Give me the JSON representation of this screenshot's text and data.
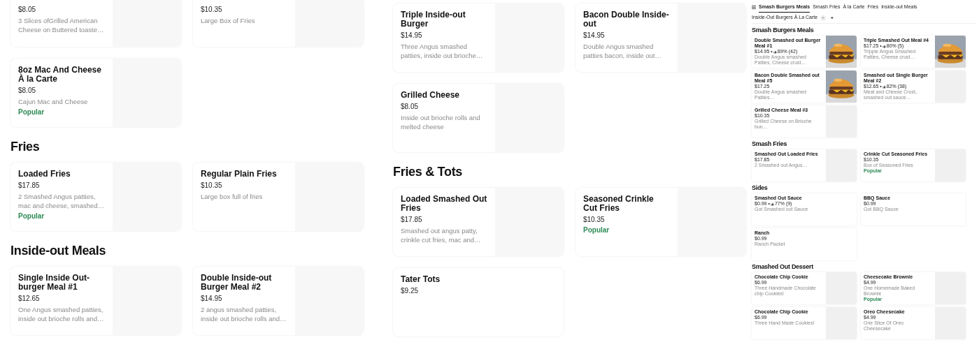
{
  "panels": [
    {
      "kind": "menu",
      "sections": [
        {
          "items": [
            {
              "cut": true,
              "price": "$8.05",
              "description": "3 Slices ofGrilled American Cheese on Buttered toaste…",
              "kind": "blank"
            },
            {
              "cut": true,
              "price": "$10.35",
              "description": "Large Box of Fries",
              "kind": "blank"
            },
            {
              "name": "8oz Mac And Cheese À la Carte",
              "price": "$8.05",
              "description": "Cajun Mac and Cheese",
              "badge": "Popular",
              "kind": "blank"
            }
          ]
        },
        {
          "heading": "Fries",
          "items": [
            {
              "name": "Loaded Fries",
              "price": "$17.85",
              "description": "2 Smashed Angus patties, mac and cheese, smashed…",
              "badge": "Popular",
              "kind": "blank"
            },
            {
              "name": "Regular Plain Fries",
              "price": "$10.35",
              "description": "Large box full of fries",
              "kind": "blank"
            }
          ]
        },
        {
          "heading": "Inside-out Meals",
          "items": [
            {
              "name": "Single Inside Out-burger Meal #1",
              "price": "$12.65",
              "description": "One Angus smashed patties, inside out brioche rolls and…",
              "kind": "blank"
            },
            {
              "name": "Double Inside-out Burger Meal #2",
              "price": "$14.95",
              "description": "2 angus smashed patties, inside out brioche rolls and…",
              "kind": "blank"
            }
          ]
        }
      ]
    },
    {
      "kind": "menu",
      "sections": [
        {
          "items": [
            {
              "name": "Triple Inside-out Burger",
              "price": "$14.95",
              "description": "Three Angus smashed patties, inside out brioche…",
              "kind": "blank"
            },
            {
              "name": "Bacon Double Inside-out",
              "price": "$14.95",
              "description": "Double Angus smashed patties bacon, inside out…",
              "kind": "blank"
            },
            {
              "name": "Grilled Cheese",
              "price": "$8.05",
              "description": "Inside out brioche rolls and melted cheese",
              "kind": "blank"
            }
          ]
        },
        {
          "heading": "Fries & Tots",
          "items": [
            {
              "name": "Loaded Smashed Out Fries",
              "price": "$17.85",
              "description": "Smashed out angus patty, crinkle cut fries, mac and…",
              "kind": "blank"
            },
            {
              "name": "Seasoned Crinkle Cut Fries",
              "price": "$10.35",
              "badge": "Popular",
              "kind": "blank"
            },
            {
              "name": "Tater Tots",
              "price": "$9.25",
              "kind": "plain"
            }
          ]
        }
      ]
    },
    {
      "kind": "store",
      "tabs": [
        {
          "label": "Smash Burgers Meals",
          "selected": true
        },
        {
          "label": "Smash Fries",
          "selected": false
        },
        {
          "label": "À la Carte",
          "selected": false
        },
        {
          "label": "Fries",
          "selected": false
        },
        {
          "label": "Inside-out Meals",
          "selected": false
        },
        {
          "label": "Inside-Out Burgers À La Carte",
          "selected": false
        }
      ],
      "sections": [
        {
          "heading": "Smash Burgers Meals",
          "items": [
            {
              "name": "Double Smashed out Burger Meal #1",
              "price": "$14.95 •",
              "rating": "89% (42)",
              "description": "Double Angus smashed Patties, Cheese crust…",
              "kind": "picture"
            },
            {
              "name": "Triple Smashed Out Meal #4",
              "price": "$17.25 •",
              "rating": "80% (5)",
              "description": "Tripple Angus Smashed Patties, Cheese crust…",
              "kind": "picture"
            },
            {
              "name": "Bacon Double Smashed out Meal #5",
              "price": "$17.25",
              "description": "Double Angus smashed Patties…",
              "kind": "picture"
            },
            {
              "name": "Smashed out Single Burger Meal #2",
              "price": "$12.65 •",
              "rating": "82% (38)",
              "description": "Meat and Cheese Crust, smashed out sauce…",
              "kind": "blank"
            },
            {
              "name": "Grilled Cheese Meal #3",
              "price": "$10.35",
              "description": "Grilled Cheese on Brioche bun…",
              "kind": "blank"
            }
          ]
        },
        {
          "heading": "Smash Fries",
          "items": [
            {
              "name": "Smashed Out Loaded Fries",
              "price": "$17.85",
              "description": "2 Smashed out Angus…",
              "kind": "blank"
            },
            {
              "name": "Crinkle Cut Seasoned Fries",
              "price": "$10.35",
              "description": "Box of Seasoned Fries",
              "badge": "Popular",
              "kind": "blank"
            }
          ]
        },
        {
          "heading": "Sides",
          "items": [
            {
              "name": "Smashed Out Sauce",
              "price": "$0.99 •",
              "rating": "77% (9)",
              "description": "Got Smashed out Sauce",
              "kind": "plain"
            },
            {
              "name": "BBQ Sauce",
              "price": "$0.99",
              "description": "Got BBQ Sauce",
              "kind": "plain"
            },
            {
              "name": "Ranch",
              "price": "$0.99",
              "description": "Ranch Packet",
              "kind": "plain"
            }
          ]
        },
        {
          "heading": "Smashed Out Dessert",
          "items": [
            {
              "name": "Chocolate Chip Cookie",
              "price": "$6.99",
              "description": "Three Handmade Chocolate chip Cookies!",
              "kind": "blank"
            },
            {
              "name": "Cheesecake Brownie",
              "price": "$4.99",
              "description": "One Homemade Baked Brownie",
              "badge": "Popular",
              "kind": "blank"
            },
            {
              "name": "Chocolate Chip Cookie",
              "price": "$6.99",
              "description": "Three Hand Made Cookies!",
              "kind": "blank"
            },
            {
              "name": "Oreo Cheesecake",
              "price": "$4.99",
              "description": "One Slice Of Oreo Cheesecake",
              "kind": "blank"
            }
          ]
        }
      ]
    }
  ]
}
